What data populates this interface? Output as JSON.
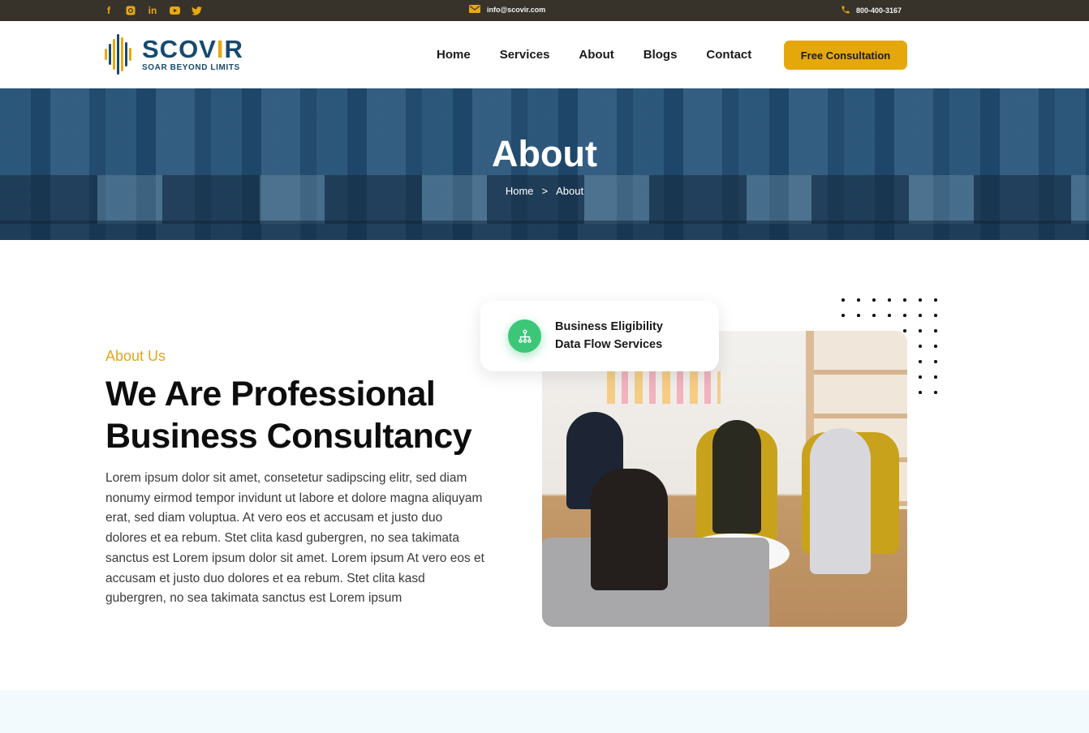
{
  "topbar": {
    "socials": [
      {
        "icon": "facebook-icon",
        "glyph": "f"
      },
      {
        "icon": "instagram-icon",
        "glyph": "◙"
      },
      {
        "icon": "linkedin-icon",
        "glyph": "in"
      },
      {
        "icon": "youtube-icon",
        "glyph": "▶"
      },
      {
        "icon": "twitter-icon",
        "glyph": "🐦"
      }
    ],
    "email": "info@scovir.com",
    "phone": "800-400-3167"
  },
  "header": {
    "logo_name_prefix": "SCOV",
    "logo_name_accent": "I",
    "logo_name_suffix": "R",
    "logo_tagline": "SOAR BEYOND LIMITS",
    "nav": [
      "Home",
      "Services",
      "About",
      "Blogs",
      "Contact"
    ],
    "cta_label": "Free Consultation"
  },
  "hero": {
    "title": "About",
    "breadcrumb": {
      "home": "Home",
      "separator": ">",
      "current": "About"
    }
  },
  "about": {
    "label": "About Us",
    "title_line1": "We Are Professional",
    "title_line2": "Business Consultancy",
    "body": "Lorem ipsum dolor sit amet, consetetur sadipscing elitr, sed diam nonumy eirmod tempor invidunt ut labore et dolore magna aliquyam erat, sed diam voluptua. At vero eos et accusam et justo duo dolores et ea rebum. Stet clita kasd gubergren, no sea takimata sanctus est Lorem ipsum dolor sit amet. Lorem ipsum At vero eos et accusam et justo duo dolores et ea rebum. Stet clita kasd gubergren, no sea takimata sanctus est Lorem ipsum",
    "card_line1": "Business Eligibility",
    "card_line2": "Data Flow Services"
  },
  "colors": {
    "accent": "#e4a80c",
    "brand_blue": "#164a6e",
    "topbar_bg": "#38332a",
    "badge_green": "#3cc678",
    "hero_overlay": "#164670"
  }
}
